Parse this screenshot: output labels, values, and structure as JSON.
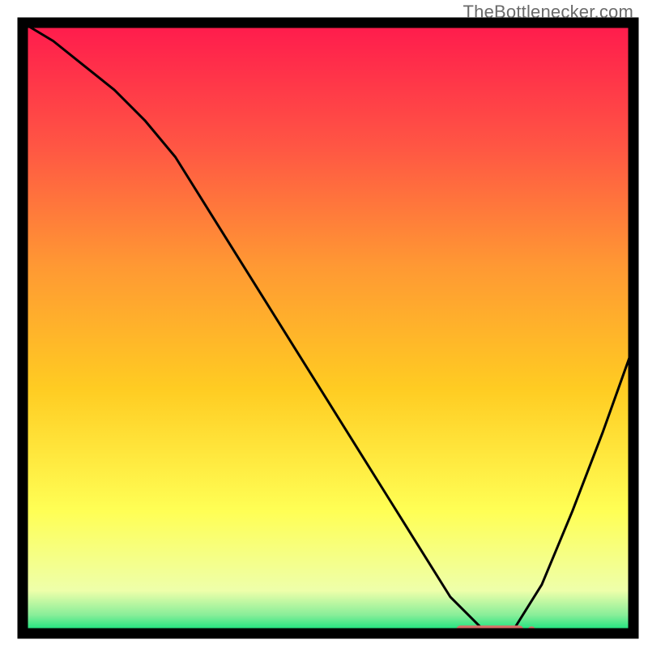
{
  "watermark": "TheBottlenecker.com",
  "chart_data": {
    "type": "line",
    "title": "",
    "xlabel": "",
    "ylabel": "",
    "xlim": [
      0,
      100
    ],
    "ylim": [
      0,
      100
    ],
    "x": [
      0,
      5,
      10,
      15,
      20,
      25,
      30,
      35,
      40,
      45,
      50,
      55,
      60,
      65,
      70,
      75,
      80,
      85,
      90,
      95,
      100
    ],
    "values": [
      100,
      97,
      93,
      89,
      84,
      78,
      70,
      62,
      54,
      46,
      38,
      30,
      22,
      14,
      6,
      1,
      0,
      8,
      20,
      33,
      47
    ],
    "minimum_marker": {
      "x_start": 71,
      "x_end": 82,
      "y": 0.5,
      "color": "#d87068"
    },
    "background": {
      "type": "vertical_gradient",
      "stops": [
        {
          "offset": 0.0,
          "color": "#ff1a4d"
        },
        {
          "offset": 0.2,
          "color": "#ff5544"
        },
        {
          "offset": 0.4,
          "color": "#ff9933"
        },
        {
          "offset": 0.6,
          "color": "#ffcc22"
        },
        {
          "offset": 0.8,
          "color": "#ffff55"
        },
        {
          "offset": 0.93,
          "color": "#eeffaa"
        },
        {
          "offset": 0.97,
          "color": "#88ee99"
        },
        {
          "offset": 1.0,
          "color": "#00e077"
        }
      ]
    },
    "border_color": "#000000",
    "line_color": "#000000"
  }
}
